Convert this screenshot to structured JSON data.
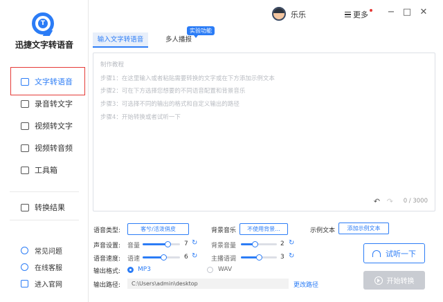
{
  "app": {
    "name": "迅捷文字转语音",
    "brand_color": "#2b7cf6"
  },
  "sidebar": {
    "items": [
      {
        "label": "文字转语音",
        "icon": "text-to-speech-icon",
        "active": true
      },
      {
        "label": "录音转文字",
        "icon": "recording-icon"
      },
      {
        "label": "视频转文字",
        "icon": "video-icon"
      },
      {
        "label": "视频转音频",
        "icon": "video-audio-icon"
      },
      {
        "label": "工具箱",
        "icon": "toolbox-icon"
      },
      {
        "label": "转换结果",
        "icon": "result-icon"
      }
    ],
    "footer": [
      {
        "label": "常见问题",
        "icon": "question-icon"
      },
      {
        "label": "在线客服",
        "icon": "service-icon"
      },
      {
        "label": "进入官网",
        "icon": "website-icon"
      }
    ]
  },
  "titlebar": {
    "username": "乐乐",
    "more_label": "更多",
    "minimize": "−",
    "maximize": "□",
    "close": "✕"
  },
  "tabs": [
    {
      "label": "输入文字转语音",
      "active": true
    },
    {
      "label": "多人播报",
      "badge": "实验功能"
    }
  ],
  "editor": {
    "placeholder_lines": [
      "制作教程",
      "步骤1：在这里输入或者粘贴需要转换的文字或在下方添加示例文本",
      "步骤2：可在下方选择您想要的不同语音配置和背景音乐",
      "步骤3：可选择不同的输出的格式和自定义输出的路径",
      "步骤4：开始转换或者试听一下"
    ],
    "counter": "0 / 3000"
  },
  "settings": {
    "voice_type_label": "语音类型:",
    "voice_type_value": "客兮/活泼俏皮",
    "bg_music_label": "背景音乐",
    "bg_music_value": "不使用背景...",
    "sample_text_label": "示例文本",
    "sample_text_button": "添加示例文本",
    "voice_settings_label": "声音设置:",
    "volume_label": "音量",
    "volume_value": "7",
    "bg_volume_label": "背景音量",
    "bg_volume_value": "2",
    "speed_label": "语音速度:",
    "rate_label": "语速",
    "rate_value": "6",
    "pitch_label": "主播语调",
    "pitch_value": "3",
    "format_label": "输出格式:",
    "format_mp3": "MP3",
    "format_wav": "WAV",
    "path_label": "输出路径:",
    "path_value": "C:\\Users\\admin\\desktop",
    "change_path": "更改路径",
    "listen_button": "试听一下",
    "convert_button": "开始转换"
  }
}
